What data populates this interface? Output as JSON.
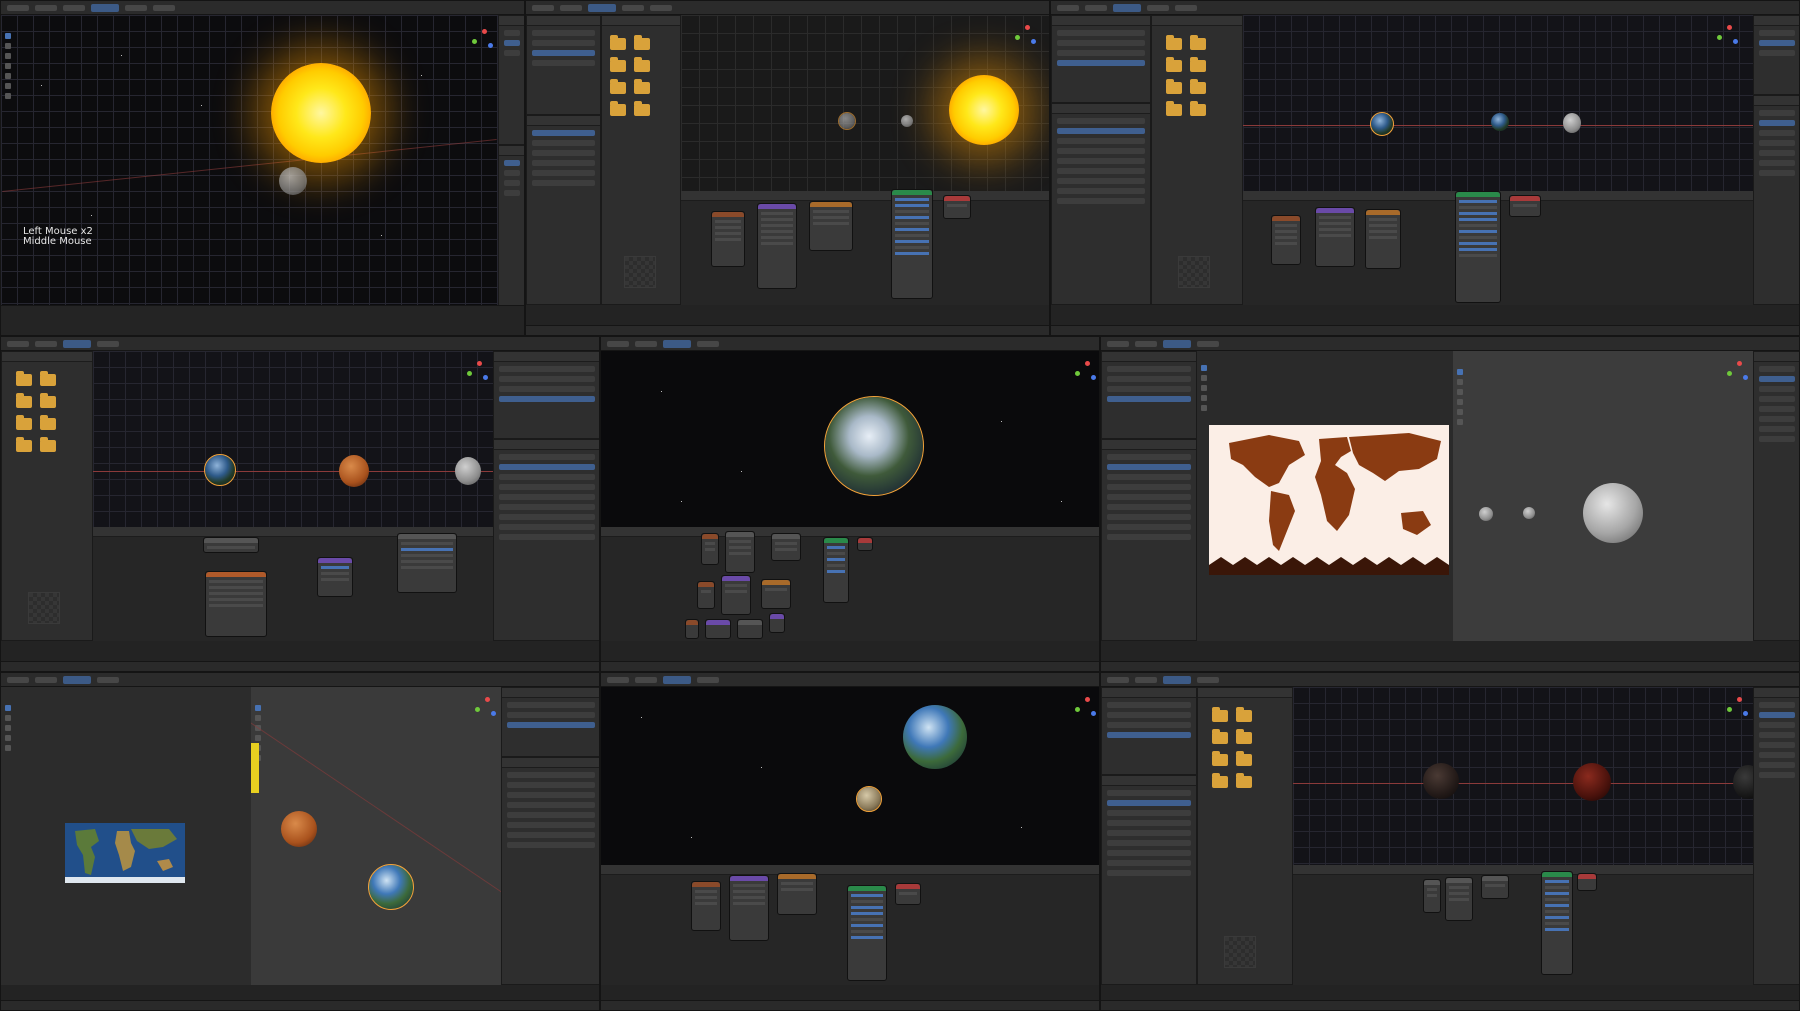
{
  "viewport_hint": {
    "line1": "Left Mouse x2",
    "line2": "Middle Mouse"
  },
  "colors": {
    "accent": "#4772b3",
    "selection": "#f3a33a",
    "folder": "#d9a23a",
    "background": "#1d1d1d",
    "panel": "#2e2e2e"
  },
  "icons": [
    "folder-icon",
    "axis-gizmo-icon",
    "tool-icon",
    "sun-icon",
    "planet-icon"
  ]
}
